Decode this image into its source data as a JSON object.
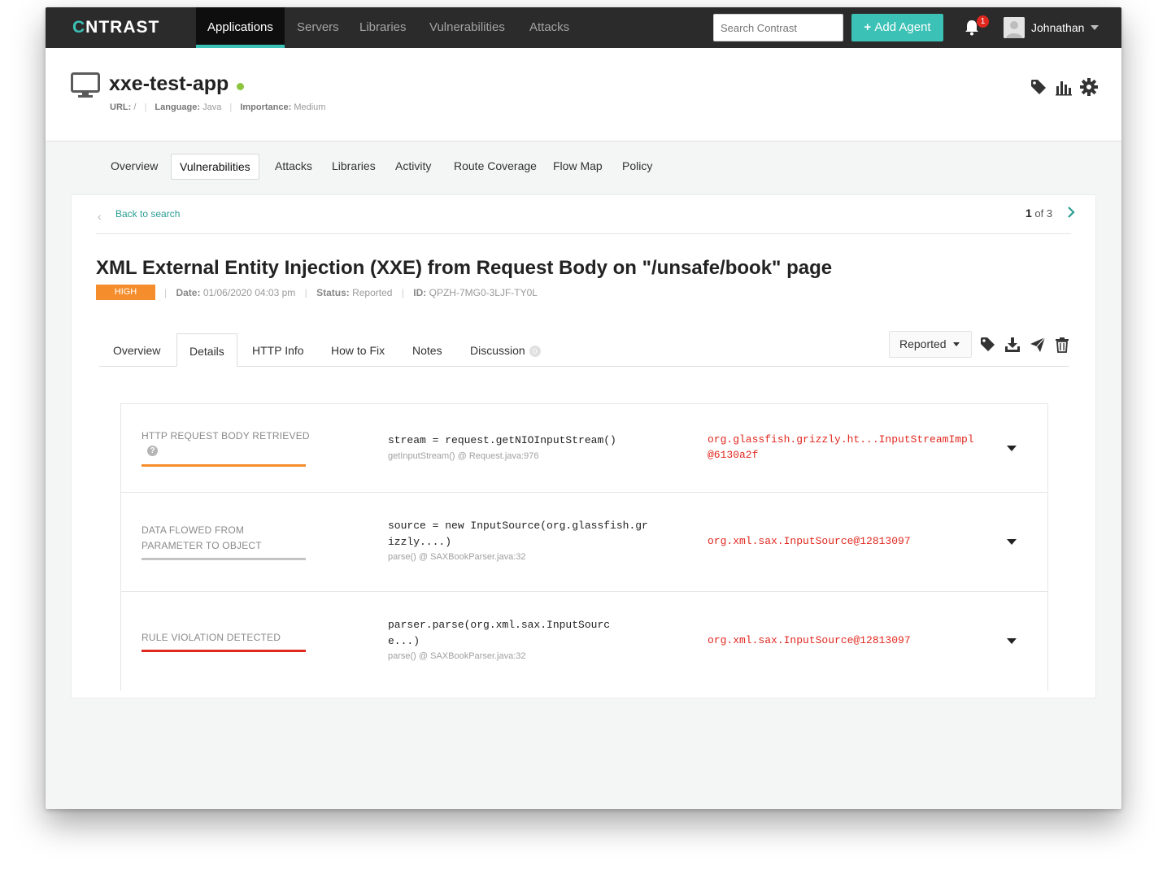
{
  "topnav": {
    "logo_prefix": "C",
    "logo_rest": "NTRAST",
    "items": [
      {
        "label": "Applications",
        "active": true
      },
      {
        "label": "Servers"
      },
      {
        "label": "Libraries"
      },
      {
        "label": "Vulnerabilities"
      },
      {
        "label": "Attacks"
      }
    ],
    "search_placeholder": "Search Contrast",
    "add_agent": "Add Agent",
    "notification_count": "1",
    "username": "Johnathan",
    "accent": "#3bc1b5"
  },
  "app": {
    "name": "xxe-test-app",
    "url_label": "URL:",
    "url_value": "/",
    "language_label": "Language:",
    "language_value": "Java",
    "importance_label": "Importance:",
    "importance_value": "Medium",
    "status_color": "#8cc63f"
  },
  "subnav": {
    "items": [
      "Overview",
      "Vulnerabilities",
      "Attacks",
      "Libraries",
      "Activity",
      "Route Coverage",
      "Flow Map",
      "Policy"
    ],
    "active": "Vulnerabilities"
  },
  "vuln": {
    "back_label": "Back to search",
    "pager_current": "1",
    "pager_rest": "of 3",
    "title": "XML External Entity Injection (XXE) from Request Body on \"/unsafe/book\" page",
    "severity": "HIGH",
    "severity_color": "#f58d2c",
    "date_label": "Date:",
    "date_value": "01/06/2020 04:03 pm",
    "status_label": "Status:",
    "status_value": "Reported",
    "id_label": "ID:",
    "id_value": "QPZH-7MG0-3LJF-TY0L"
  },
  "detail_tabs": {
    "items": [
      "Overview",
      "Details",
      "HTTP Info",
      "How to Fix",
      "Notes",
      "Discussion"
    ],
    "active": "Details",
    "discussion_count": "0",
    "status_dropdown": "Reported"
  },
  "trace": [
    {
      "name": "HTTP REQUEST BODY RETRIEVED",
      "bar_color": "#f58d2c",
      "has_help": true,
      "help_glyph": "?",
      "code": "stream = request.getNIOInputStream()",
      "location": "getInputStream() @ Request.java:976",
      "object": "org.glassfish.grizzly.ht...InputStreamImpl@6130a2f"
    },
    {
      "name": "DATA FLOWED FROM PARAMETER TO OBJECT",
      "bar_color": "#c4c4c4",
      "has_help": false,
      "code": "source = new InputSource(org.glassfish.grizzly....)",
      "location": "parse() @ SAXBookParser.java:32",
      "object": "org.xml.sax.InputSource@12813097"
    },
    {
      "name": "RULE VIOLATION DETECTED",
      "bar_color": "#e0281f",
      "has_help": false,
      "code": "parser.parse(org.xml.sax.InputSource...)",
      "location": "parse() @ SAXBookParser.java:32",
      "object": "org.xml.sax.InputSource@12813097"
    }
  ]
}
